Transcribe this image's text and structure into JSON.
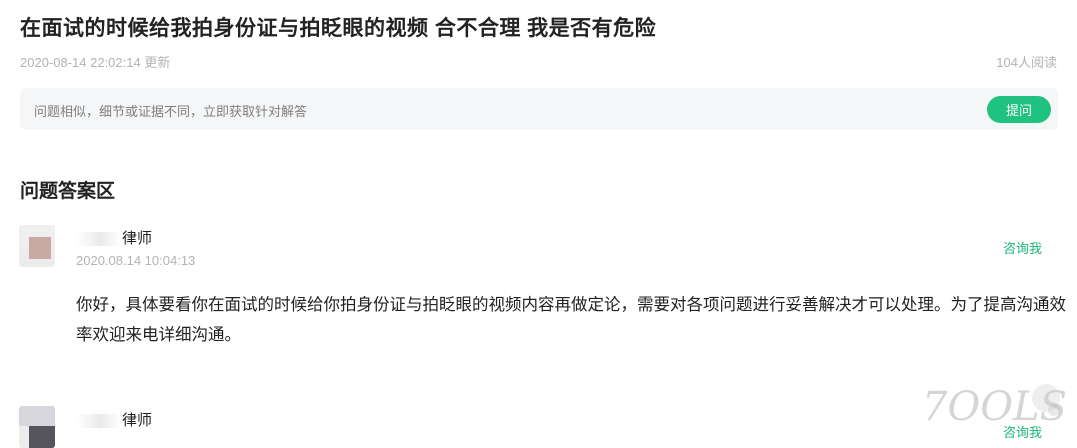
{
  "question": {
    "title": "在面试的时候给我拍身份证与拍眨眼的视频 合不合理 我是否有危险",
    "updated": "2020-08-14 22:02:14 更新",
    "reads": "104人阅读"
  },
  "ask_bar": {
    "placeholder": "问题相似，细节或证据不同，立即获取针对解答",
    "button": "提问"
  },
  "answers_section": {
    "title": "问题答案区"
  },
  "answers": [
    {
      "lawyer": "律师",
      "time": "2020.08.14 10:04:13",
      "consult": "咨询我",
      "content": "你好，具体要看你在面试的时候给你拍身份证与拍眨眼的视频内容再做定论，需要对各项问题进行妥善解决才可以处理。为了提高沟通效率欢迎来电详细沟通。"
    },
    {
      "lawyer": "律师",
      "consult": "咨询我"
    }
  ],
  "watermark": "7OOLS",
  "colors": {
    "accent": "#1fc27e",
    "link": "#1fb57a",
    "muted": "#b3b3b3",
    "bar_bg": "#f5f6f7"
  }
}
